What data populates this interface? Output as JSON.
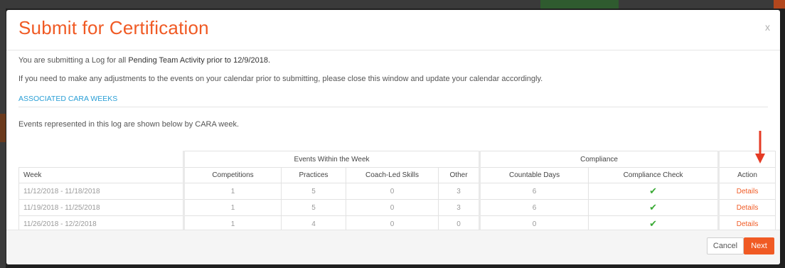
{
  "modal": {
    "title": "Submit for Certification",
    "close_glyph": "x"
  },
  "body": {
    "intro_prefix": "You are submitting a Log for all ",
    "intro_bold": "Pending Team Activity prior to 12/9/2018.",
    "adjust_note": "If you need to make any adjustments to the events on your calendar prior to submitting, please close this window and update your calendar accordingly.",
    "section_link": "ASSOCIATED CARA WEEKS",
    "events_caption": "Events represented in this log are shown below by CARA week."
  },
  "table": {
    "group_events": "Events Within the Week",
    "group_compliance": "Compliance",
    "headers": {
      "week": "Week",
      "competitions": "Competitions",
      "practices": "Practices",
      "coach_led": "Coach-Led Skills",
      "other": "Other",
      "countable_days": "Countable Days",
      "compliance_check": "Compliance Check",
      "action": "Action"
    },
    "rows": [
      {
        "week": "11/12/2018 - 11/18/2018",
        "competitions": "1",
        "practices": "5",
        "coach_led": "0",
        "other": "3",
        "countable_days": "6",
        "check": "✔",
        "action": "Details"
      },
      {
        "week": "11/19/2018 - 11/25/2018",
        "competitions": "1",
        "practices": "5",
        "coach_led": "0",
        "other": "3",
        "countable_days": "6",
        "check": "✔",
        "action": "Details"
      },
      {
        "week": "11/26/2018 - 12/2/2018",
        "competitions": "1",
        "practices": "4",
        "coach_led": "0",
        "other": "0",
        "countable_days": "0",
        "check": "✔",
        "action": "Details"
      }
    ]
  },
  "footer": {
    "cancel_label": "Cancel",
    "next_label": "Next"
  },
  "colors": {
    "accent": "#f05a24",
    "link": "#2a9fd6",
    "check": "#3aaa35",
    "arrow": "#e53b25"
  },
  "icons": {
    "close": "close-icon",
    "check": "checkmark-icon",
    "arrow": "red-down-arrow-annotation"
  }
}
